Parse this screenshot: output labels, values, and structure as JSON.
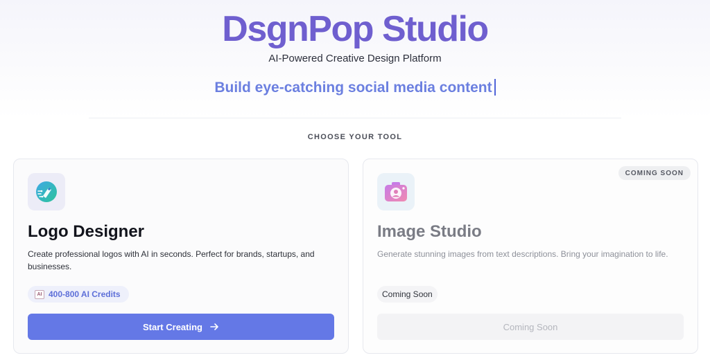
{
  "header": {
    "brand": "DsgnPop Studio",
    "tagline": "AI-Powered Creative Design Platform",
    "typing_text": "Build eye-catching social media content"
  },
  "section_label": "CHOOSE YOUR TOOL",
  "cards": [
    {
      "icon": "pen-nib-circuit-icon",
      "title": "Logo Designer",
      "description": "Create professional logos with AI in seconds. Perfect for brands, startups, and businesses.",
      "credits_icon": "AI",
      "credits": "400-800 AI Credits",
      "button_label": "Start Creating",
      "button_icon": "arrow-right-icon"
    },
    {
      "icon": "camera-icon",
      "badge": "COMING SOON",
      "title": "Image Studio",
      "description": "Generate stunning images from text descriptions. Bring your imagination to life.",
      "status_chip": "Coming Soon",
      "button_label": "Coming Soon"
    }
  ],
  "colors": {
    "brand": "#6f5fcf",
    "accent": "#6478e6",
    "typing": "#6b7fe0"
  }
}
